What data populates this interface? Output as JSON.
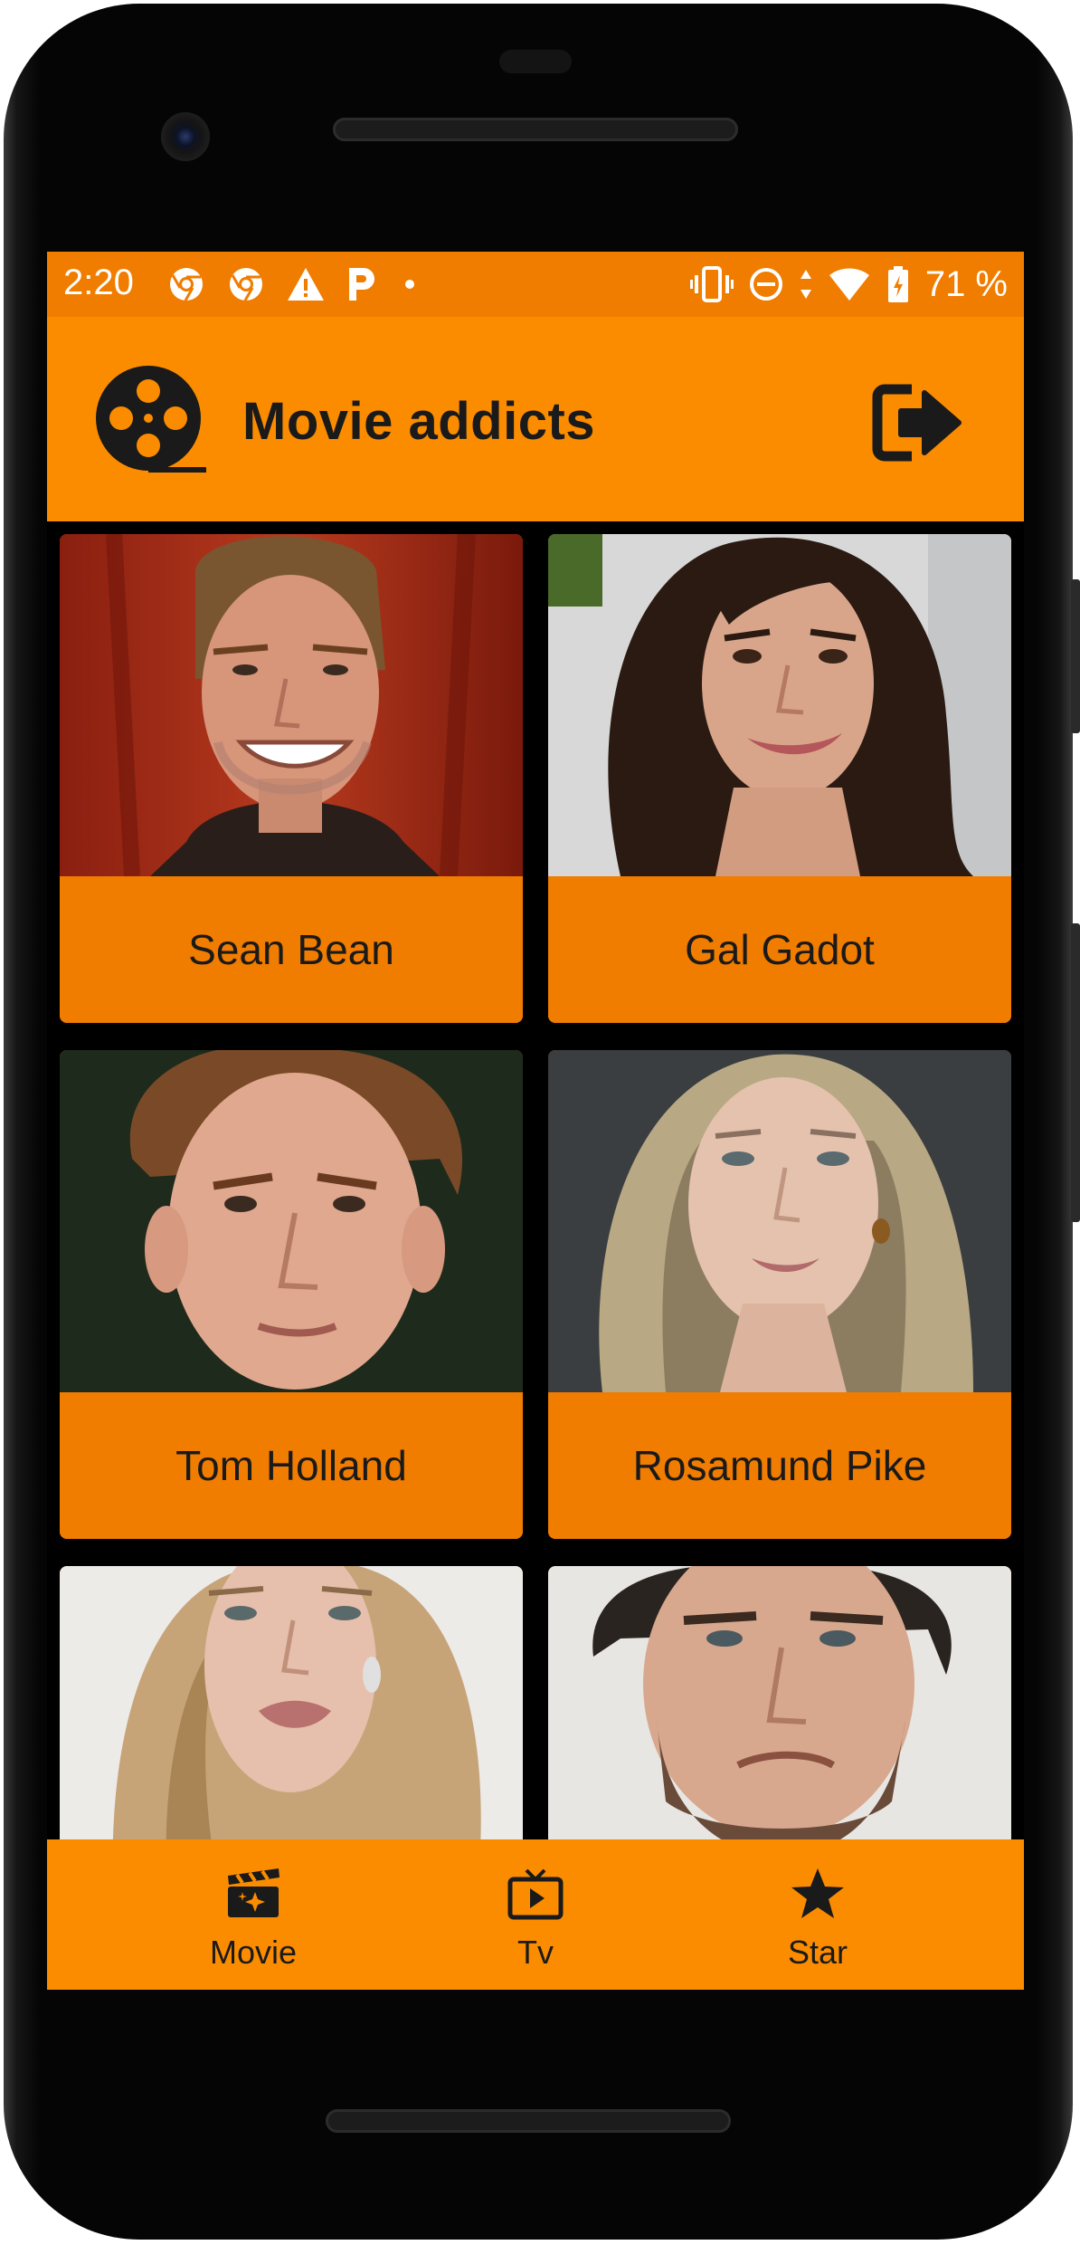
{
  "status_bar": {
    "time": "2:20",
    "left_icons": [
      "chrome-icon",
      "chrome-icon",
      "warning-icon",
      "parking-icon",
      "dot-icon"
    ],
    "right_icons": [
      "vibrate-icon",
      "do-not-disturb-icon",
      "data-arrows-icon",
      "wifi-icon",
      "battery-charging-icon"
    ],
    "battery": "71 %"
  },
  "app_bar": {
    "title": "Movie addicts",
    "logo_icon": "film-reel-icon",
    "action_icon": "logout-icon"
  },
  "stars": [
    {
      "name": "Sean Bean"
    },
    {
      "name": "Gal Gadot"
    },
    {
      "name": "Tom Holland"
    },
    {
      "name": "Rosamund Pike"
    },
    {
      "name": ""
    },
    {
      "name": ""
    }
  ],
  "bottom_nav": {
    "items": [
      {
        "label": "Movie",
        "icon": "movie-clapper-icon"
      },
      {
        "label": "Tv",
        "icon": "tv-icon"
      },
      {
        "label": "Star",
        "icon": "star-icon"
      }
    ]
  },
  "colors": {
    "status_bar": "#f07c00",
    "app_bar": "#fb8c00",
    "card": "#f07c00",
    "text": "#1a1a1a",
    "background": "#000000"
  }
}
